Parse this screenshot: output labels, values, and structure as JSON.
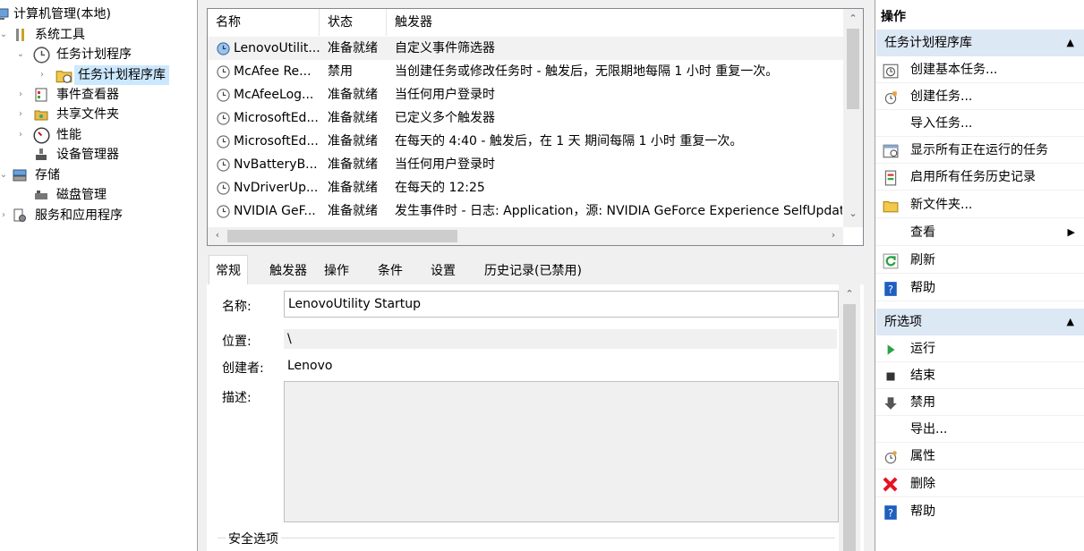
{
  "tree": {
    "items": [
      {
        "label": "计算机管理(本地)",
        "icon": "computer-icon"
      },
      {
        "label": "系统工具",
        "icon": "tools-icon",
        "arrow": "⌄"
      },
      {
        "label": "任务计划程序",
        "icon": "clock-icon",
        "arrow": "⌄"
      },
      {
        "label": "任务计划程序库",
        "icon": "folder-clock-icon",
        "arrow": "›",
        "selected": true
      },
      {
        "label": "事件查看器",
        "icon": "event-viewer-icon",
        "arrow": "›"
      },
      {
        "label": "共享文件夹",
        "icon": "shared-folder-icon",
        "arrow": "›"
      },
      {
        "label": "性能",
        "icon": "performance-icon",
        "arrow": "›"
      },
      {
        "label": "设备管理器",
        "icon": "device-manager-icon"
      },
      {
        "label": "存储",
        "icon": "storage-icon",
        "arrow": "⌄"
      },
      {
        "label": "磁盘管理",
        "icon": "disk-icon"
      },
      {
        "label": "服务和应用程序",
        "icon": "services-icon",
        "arrow": "›"
      }
    ]
  },
  "task_list": {
    "columns": [
      "名称",
      "状态",
      "触发器"
    ],
    "rows": [
      {
        "name": "LenovoUtilit...",
        "status": "准备就绪",
        "trigger": "自定义事件筛选器"
      },
      {
        "name": "McAfee Re...",
        "status": "禁用",
        "trigger": "当创建任务或修改任务时 - 触发后，无限期地每隔 1 小时 重复一次。"
      },
      {
        "name": "McAfeeLog...",
        "status": "准备就绪",
        "trigger": "当任何用户登录时"
      },
      {
        "name": "MicrosoftEd...",
        "status": "准备就绪",
        "trigger": "已定义多个触发器"
      },
      {
        "name": "MicrosoftEd...",
        "status": "准备就绪",
        "trigger": "在每天的 4:40 - 触发后，在 1 天 期间每隔 1 小时 重复一次。"
      },
      {
        "name": "NvBatteryB...",
        "status": "准备就绪",
        "trigger": "当任何用户登录时"
      },
      {
        "name": "NvDriverUp...",
        "status": "准备就绪",
        "trigger": "在每天的 12:25"
      },
      {
        "name": "NVIDIA GeF...",
        "status": "准备就绪",
        "trigger": "发生事件时 - 日志: Application，源: NVIDIA GeForce Experience SelfUpdat"
      }
    ]
  },
  "details": {
    "tabs": [
      "常规",
      "触发器",
      "操作",
      "条件",
      "设置",
      "历史记录(已禁用)"
    ],
    "name_label": "名称:",
    "name_value": "LenovoUtility Startup",
    "location_label": "位置:",
    "location_value": "\\",
    "author_label": "创建者:",
    "author_value": "Lenovo",
    "description_label": "描述:",
    "security_group": "安全选项"
  },
  "actions": {
    "title": "操作",
    "section1": {
      "title": "任务计划程序库",
      "items": [
        {
          "label": "创建基本任务...",
          "icon": "create-basic-task-icon"
        },
        {
          "label": "创建任务...",
          "icon": "create-task-icon"
        },
        {
          "label": "导入任务...",
          "icon": ""
        },
        {
          "label": "显示所有正在运行的任务",
          "icon": "running-tasks-icon"
        },
        {
          "label": "启用所有任务历史记录",
          "icon": "history-icon"
        },
        {
          "label": "新文件夹...",
          "icon": "new-folder-icon"
        },
        {
          "label": "查看",
          "icon": "",
          "submenu": true
        },
        {
          "label": "刷新",
          "icon": "refresh-icon"
        },
        {
          "label": "帮助",
          "icon": "help-icon"
        }
      ]
    },
    "section2": {
      "title": "所选项",
      "items": [
        {
          "label": "运行",
          "icon": "run-icon"
        },
        {
          "label": "结束",
          "icon": "end-icon"
        },
        {
          "label": "禁用",
          "icon": "disable-icon"
        },
        {
          "label": "导出...",
          "icon": ""
        },
        {
          "label": "属性",
          "icon": "properties-icon"
        },
        {
          "label": "删除",
          "icon": "delete-icon"
        },
        {
          "label": "帮助",
          "icon": "help-icon"
        }
      ]
    }
  },
  "colors": {
    "selection": "#cce8ff",
    "section_header": "#dde8f5",
    "run_green": "#2ea043",
    "delete_red": "#e81123",
    "help_blue": "#1f5fbf"
  }
}
